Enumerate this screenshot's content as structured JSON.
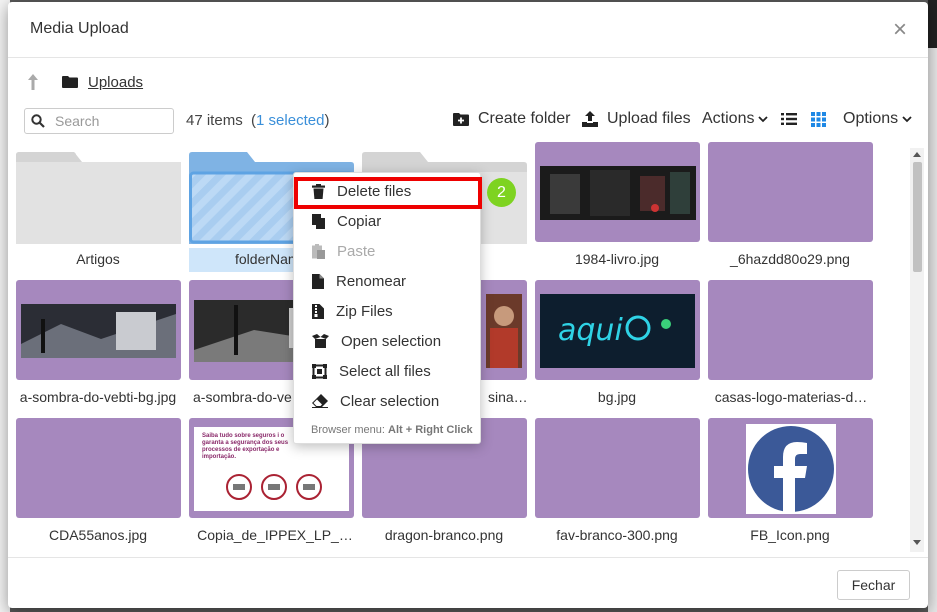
{
  "modal": {
    "title": "Media Upload",
    "close_label": "×"
  },
  "breadcrumb": {
    "folder": "Uploads"
  },
  "search": {
    "placeholder": "Search",
    "value": ""
  },
  "status": {
    "items": "47 items",
    "open_paren": "(",
    "selected": "1 selected",
    "close_paren": ")"
  },
  "toolbar": {
    "create_folder": "Create folder",
    "upload_files": "Upload files",
    "actions": "Actions",
    "options": "Options"
  },
  "tiles": [
    {
      "label": "Artigos",
      "kind": "folder"
    },
    {
      "label": "folderNam",
      "kind": "folder-selected"
    },
    {
      "label": "",
      "kind": "folder"
    },
    {
      "label": "1984-livro.jpg",
      "kind": "image"
    },
    {
      "label": "_6hazdd80o29.png",
      "kind": "image"
    },
    {
      "label": "a-sombra-do-vebti-bg.jpg",
      "kind": "image"
    },
    {
      "label": "a-sombra-do-ve",
      "kind": "image"
    },
    {
      "label": "sina…",
      "kind": "image"
    },
    {
      "label": "bg.jpg",
      "kind": "image"
    },
    {
      "label": "casas-logo-materias-d…",
      "kind": "image"
    },
    {
      "label": "CDA55anos.jpg",
      "kind": "image"
    },
    {
      "label": "Copia_de_IPPEX_LP_…",
      "kind": "image"
    },
    {
      "label": "dragon-branco.png",
      "kind": "image"
    },
    {
      "label": "fav-branco-300.png",
      "kind": "image"
    },
    {
      "label": "FB_Icon.png",
      "kind": "image"
    }
  ],
  "context_menu": {
    "items": [
      {
        "label": "Delete files",
        "icon": "trash-icon",
        "disabled": false
      },
      {
        "label": "Copiar",
        "icon": "copy-icon",
        "disabled": false
      },
      {
        "label": "Paste",
        "icon": "paste-icon",
        "disabled": true
      },
      {
        "label": "Renomear",
        "icon": "file-icon",
        "disabled": false
      },
      {
        "label": "Zip Files",
        "icon": "zip-icon",
        "disabled": false
      },
      {
        "label": "Open selection",
        "icon": "open-box-icon",
        "disabled": false
      },
      {
        "label": "Select all files",
        "icon": "select-all-icon",
        "disabled": false
      },
      {
        "label": "Clear selection",
        "icon": "eraser-icon",
        "disabled": false
      }
    ],
    "footer_prefix": "Browser menu: ",
    "footer_keys": "Alt + Right Click"
  },
  "annotation_badge": "2",
  "copia_thumb_text": "Saiba tudo sobre seguros i o garanta a segurança dos seus processos de exportação e importação.",
  "footer": {
    "close_button": "Fechar"
  },
  "colors": {
    "accent": "#3a8fd9",
    "tile_purple": "#a688be",
    "highlight": "#e00000",
    "badge": "#7ed321"
  }
}
